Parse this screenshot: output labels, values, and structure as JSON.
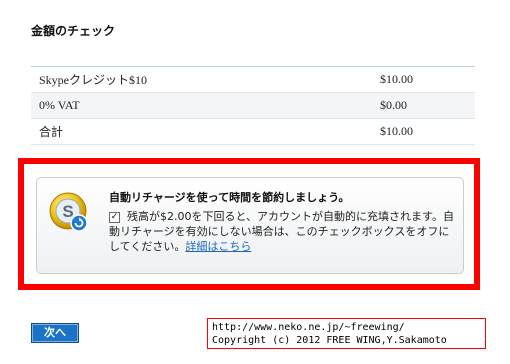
{
  "page": {
    "title": "金額のチェック"
  },
  "summary": {
    "rows": [
      {
        "label": "Skypeクレジット$10",
        "amount": "$10.00"
      },
      {
        "label": "0% VAT",
        "amount": "$0.00"
      },
      {
        "label": "合計",
        "amount": "$10.00"
      }
    ]
  },
  "promo": {
    "heading": "自動リチャージを使って時間を節約しましょう。",
    "checkbox_checked": true,
    "checkmark": "✓",
    "body": "残高が$2.00を下回ると、アカウントが自動的に充填されます。自動リチャージを有効にしない場合は、このチェックボックスをオフにしてください。",
    "link": "詳細はこちら"
  },
  "actions": {
    "next_label": "次へ"
  },
  "footer": {
    "line1": "http://www.neko.ne.jp/~freewing/",
    "line2": "Copyright (c) 2012 FREE WING,Y.Sakamoto"
  },
  "colors": {
    "highlight": "#ff0000",
    "button": "#1a73c6",
    "link": "#1a66c6"
  }
}
